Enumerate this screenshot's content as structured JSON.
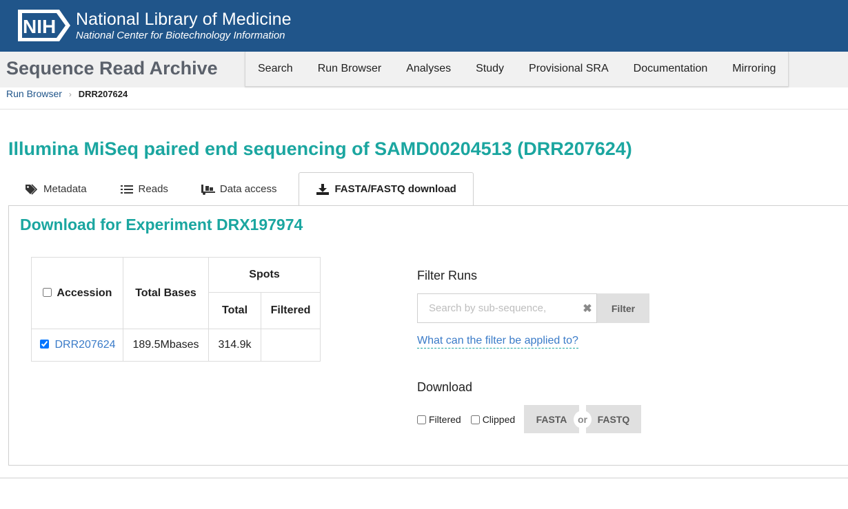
{
  "nih": {
    "logo_text": "NIH",
    "title": "National Library of Medicine",
    "subtitle": "National Center for Biotechnology Information"
  },
  "sra": {
    "title": "Sequence Read Archive",
    "nav": [
      "Search",
      "Run Browser",
      "Analyses",
      "Study",
      "Provisional SRA",
      "Documentation",
      "Mirroring"
    ]
  },
  "breadcrumb": {
    "parent": "Run Browser",
    "current": "DRR207624"
  },
  "page_title": "Illumina MiSeq paired end sequencing of SAMD00204513 (DRR207624)",
  "tabs": [
    {
      "label": "Metadata",
      "icon": "tags-icon"
    },
    {
      "label": "Reads",
      "icon": "list-icon"
    },
    {
      "label": "Data access",
      "icon": "truck-loading-icon"
    },
    {
      "label": "FASTA/FASTQ download",
      "icon": "download-icon",
      "active": true
    }
  ],
  "download_title": "Download for Experiment DRX197974",
  "table": {
    "col_accession": "Accession",
    "col_total_bases": "Total Bases",
    "col_spots": "Spots",
    "col_spots_total": "Total",
    "col_spots_filtered": "Filtered",
    "rows": [
      {
        "accession": "DRR207624",
        "total_bases": "189.5Mbases",
        "spots_total": "314.9k",
        "spots_filtered": "",
        "checked": true
      }
    ]
  },
  "filter": {
    "heading": "Filter Runs",
    "placeholder": "Search by sub-sequence,",
    "clear_icon": "✖",
    "button": "Filter",
    "help_link": "What can the filter be applied to?"
  },
  "download": {
    "heading": "Download",
    "option_filtered": "Filtered",
    "option_clipped": "Clipped",
    "fasta_button": "FASTA",
    "or": "or",
    "fastq_button": "FASTQ"
  }
}
